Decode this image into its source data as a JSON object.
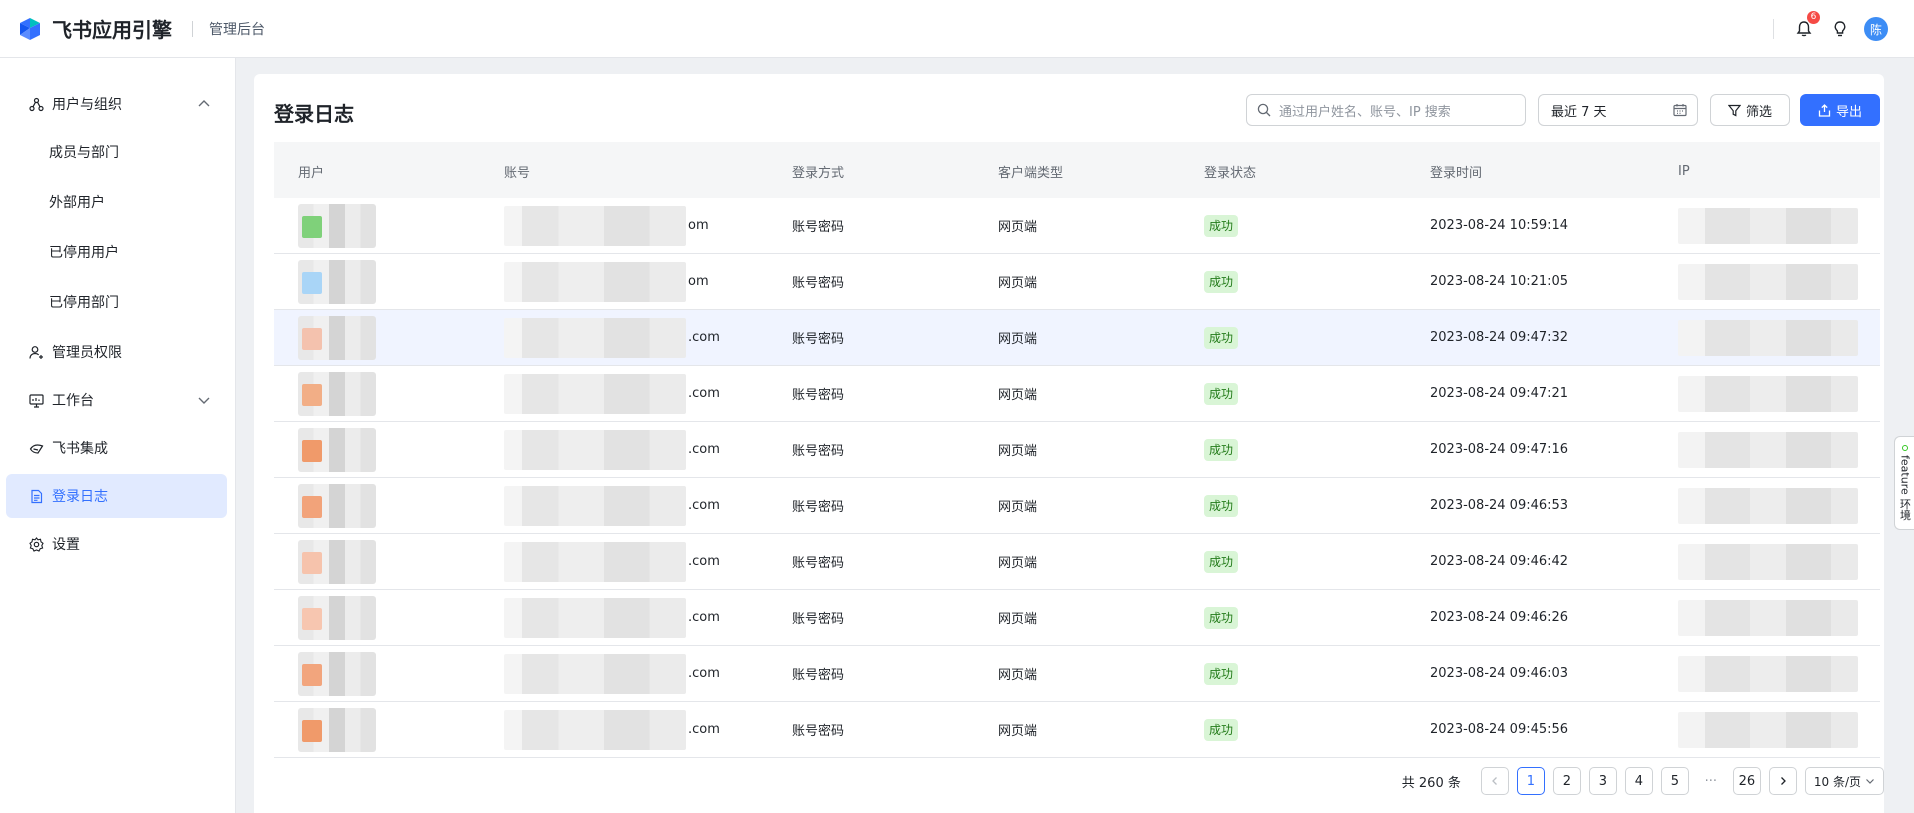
{
  "app": {
    "name": "飞书应用引擎",
    "section": "管理后台"
  },
  "topbar": {
    "notification_count": "6",
    "avatar_text": "陈"
  },
  "sidebar": {
    "items": [
      {
        "label": "用户与组织",
        "icon": "org-icon",
        "expanded": true
      },
      {
        "label": "成员与部门"
      },
      {
        "label": "外部用户"
      },
      {
        "label": "已停用用户"
      },
      {
        "label": "已停用部门"
      },
      {
        "label": "管理员权限",
        "icon": "admin-icon"
      },
      {
        "label": "工作台",
        "icon": "workbench-icon",
        "expanded": false
      },
      {
        "label": "飞书集成",
        "icon": "integration-icon"
      },
      {
        "label": "登录日志",
        "icon": "document-icon",
        "active": true
      },
      {
        "label": "设置",
        "icon": "gear-icon"
      }
    ]
  },
  "page": {
    "title": "登录日志"
  },
  "toolbar": {
    "search_placeholder": "通过用户姓名、账号、IP 搜索",
    "date_range": "最近 7 天",
    "filter_label": "筛选",
    "export_label": "导出"
  },
  "table": {
    "columns": [
      "用户",
      "账号",
      "登录方式",
      "客户端类型",
      "登录状态",
      "登录时间",
      "IP"
    ],
    "rows": [
      {
        "account_suffix": "om",
        "method": "账号密码",
        "client": "网页端",
        "status": "成功",
        "time": "2023-08-24 10:59:14",
        "avatar_color": "#7fd17a"
      },
      {
        "account_suffix": "om",
        "method": "账号密码",
        "client": "网页端",
        "status": "成功",
        "time": "2023-08-24 10:21:05",
        "avatar_color": "#a9d5f7"
      },
      {
        "account_suffix": ".com",
        "method": "账号密码",
        "client": "网页端",
        "status": "成功",
        "time": "2023-08-24 09:47:32",
        "avatar_color": "#f4c2ae"
      },
      {
        "account_suffix": ".com",
        "method": "账号密码",
        "client": "网页端",
        "status": "成功",
        "time": "2023-08-24 09:47:21",
        "avatar_color": "#f2ae86"
      },
      {
        "account_suffix": ".com",
        "method": "账号密码",
        "client": "网页端",
        "status": "成功",
        "time": "2023-08-24 09:47:16",
        "avatar_color": "#f09a6a"
      },
      {
        "account_suffix": ".com",
        "method": "账号密码",
        "client": "网页端",
        "status": "成功",
        "time": "2023-08-24 09:46:53",
        "avatar_color": "#f2a37a"
      },
      {
        "account_suffix": ".com",
        "method": "账号密码",
        "client": "网页端",
        "status": "成功",
        "time": "2023-08-24 09:46:42",
        "avatar_color": "#f6c3ac"
      },
      {
        "account_suffix": ".com",
        "method": "账号密码",
        "client": "网页端",
        "status": "成功",
        "time": "2023-08-24 09:46:26",
        "avatar_color": "#f7c6b0"
      },
      {
        "account_suffix": ".com",
        "method": "账号密码",
        "client": "网页端",
        "status": "成功",
        "time": "2023-08-24 09:46:03",
        "avatar_color": "#f2a57d"
      },
      {
        "account_suffix": ".com",
        "method": "账号密码",
        "client": "网页端",
        "status": "成功",
        "time": "2023-08-24 09:45:56",
        "avatar_color": "#f09a6a"
      }
    ]
  },
  "pagination": {
    "total": "共 260 条",
    "pages": [
      "1",
      "2",
      "3",
      "4",
      "5"
    ],
    "ellipsis": "···",
    "last_page": "26",
    "page_size": "10 条/页"
  },
  "feature_tab": {
    "label": "feature 环境"
  },
  "colors": {
    "accent": "#3370ff",
    "success_bg": "#d9f5d6",
    "success_text": "#237b19"
  }
}
